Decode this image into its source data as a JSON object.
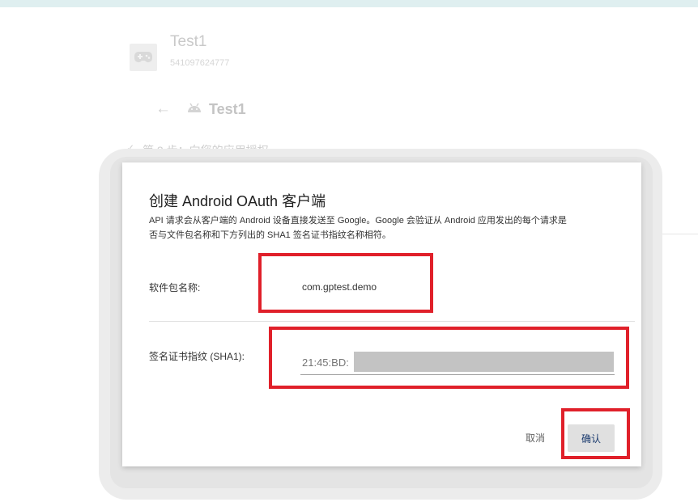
{
  "background": {
    "game_title": "Test1",
    "game_id": "541097624777",
    "back_icon": "arrow-left-icon",
    "platform_icon": "android-icon",
    "app_name": "Test1",
    "step_text": "第 2 步：向您的应用授权"
  },
  "dialog": {
    "title": "创建 Android OAuth 客户端",
    "description_lines": [
      "API 请求会从客户端的 Android 设备直接发送至 Google。Google 会验证从 Android 应用发出的每个请求是",
      "否与文件包名称和下方列出的 SHA1 签名证书指纹名称相符。"
    ],
    "package_label": "软件包名称:",
    "package_value": "com.gptest.demo",
    "sha_label": "签名证书指纹 (SHA1):",
    "sha_value_visible": "21:45:BD:",
    "cancel_label": "取消",
    "confirm_label": "确认"
  },
  "colors": {
    "highlight": "#e0202a",
    "top_strip": "#dfeff0",
    "confirm_text": "#1a3a6e"
  }
}
